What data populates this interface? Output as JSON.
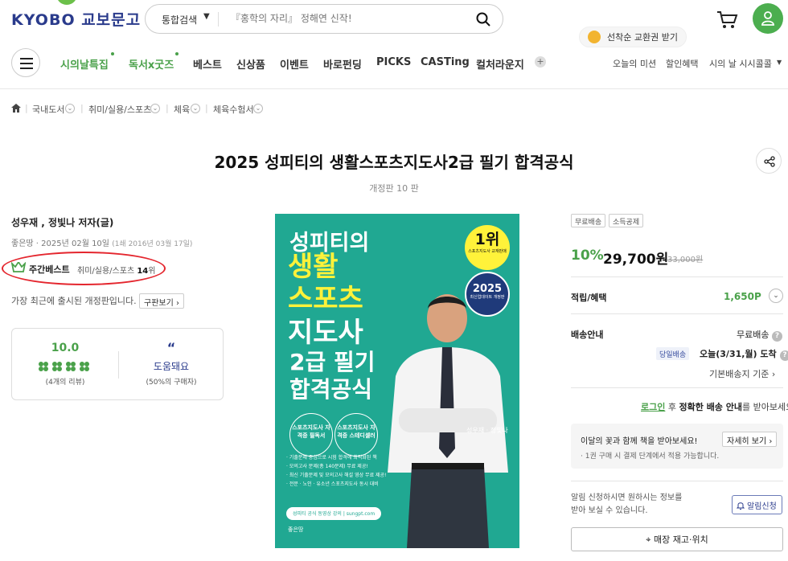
{
  "header": {
    "logo_text": "KYOBO 교보문고",
    "search": {
      "category": "통합검색",
      "placeholder": "『홍학의 자리』 정해연 신작!"
    },
    "promo": "선착순 교환권 받기"
  },
  "nav": {
    "items": [
      {
        "label": "시의날특집",
        "highlight": true
      },
      {
        "label": "독서x굿즈",
        "highlight": true
      },
      {
        "label": "베스트",
        "highlight": false
      },
      {
        "label": "신상품",
        "highlight": false
      },
      {
        "label": "이벤트",
        "highlight": false
      },
      {
        "label": "바로펀딩",
        "highlight": false
      },
      {
        "label": "PICKS",
        "highlight": false
      },
      {
        "label": "CASTing",
        "highlight": false
      },
      {
        "label": "컬처라운지",
        "highlight": false
      }
    ],
    "plus": "+",
    "utility": [
      "오늘의 미션",
      "할인혜택",
      "시의 날 시시콜콜"
    ]
  },
  "breadcrumb": [
    "국내도서",
    "취미/실용/스포츠",
    "체육",
    "체육수험서"
  ],
  "product": {
    "title": "2025 성피티의 생활스포츠지도사2급 필기 합격공식",
    "edition": "개정판 10 판",
    "author": "성우재 , 정빛나 저자(글)",
    "publisher_line": "좋은땅 · 2025년 02월 10일",
    "first_edition": "(1쇄 2016년 03월 17일)",
    "bestseller": {
      "label": "주간베스트",
      "category_prefix": "취미/실용/스포츠",
      "rank": "14",
      "rank_suffix": "위"
    },
    "recent_note": "가장 최근에 출시된 개정판입니다.",
    "old_version_button": "구판보기",
    "review": {
      "score": "10.0",
      "count_text": "(4개의 리뷰)",
      "helpful_label": "도움돼요",
      "helpful_pct": "(50%의 구매자)"
    }
  },
  "cover": {
    "line1": "성피티의",
    "line2": "생활",
    "line3": "스포츠",
    "line4": "지도사",
    "line5": "2급 필기",
    "line6": "합격공식",
    "badge1_num": "1위",
    "badge1_sub": "스포츠지도사 교재판매",
    "badge2_num": "2025",
    "badge2_sub": "최신업데이트 개정판",
    "authors": "성우재 · 정빛나",
    "circle1": "스포츠지도사 자격증 필독서",
    "circle2": "스포츠지도사 자격증 스테디셀러",
    "bullets": [
      "· 기출문제 중심으로 시험 합격에 최적화된 책",
      "· 모의고사 문제(총 140문제) 무료 제공!",
      "· 최신 기출문제 및 모의고사 해설 영상 무료 제공!",
      "· 전문 · 노인 · 유소년 스포츠지도사 동시 대비"
    ],
    "site": "성피티 공식 동영상 강의 | sungpt.com",
    "publisher": "좋은땅"
  },
  "purchase": {
    "tags": [
      "무료배송",
      "소득공제"
    ],
    "discount": "10%",
    "price": "29,700원",
    "original_price": "33,000원",
    "points_label": "적립/혜택",
    "points_value": "1,650P",
    "shipping_label": "배송안내",
    "shipping_value": "무료배송",
    "sameday_tag": "당일배송",
    "delivery_date": "오늘(3/31,월) 도착",
    "default_address": "기본배송지 기준",
    "login_link": "로그인",
    "login_mid": "후",
    "login_bold": "정확한 배송 안내",
    "login_tail": "를 받아보세요!",
    "gift_title": "이달의 꽃과 함께 책을 받아보세요!",
    "gift_sub": "· 1권 구매 시 결제 단계에서 적용 가능합니다.",
    "gift_button": "자세히 보기",
    "notify_text_1": "알림 신청하시면 원하시는 정보를",
    "notify_text_2": "받아 보실 수 있습니다.",
    "notify_button": "알림신청",
    "store_button": "매장 재고·위치"
  },
  "colors": {
    "brand_navy": "#2a3b8c",
    "brand_green": "#4aa14a",
    "cover_teal": "#20a892",
    "cover_yellow": "#fff23a",
    "highlight_red": "#e4262e"
  }
}
